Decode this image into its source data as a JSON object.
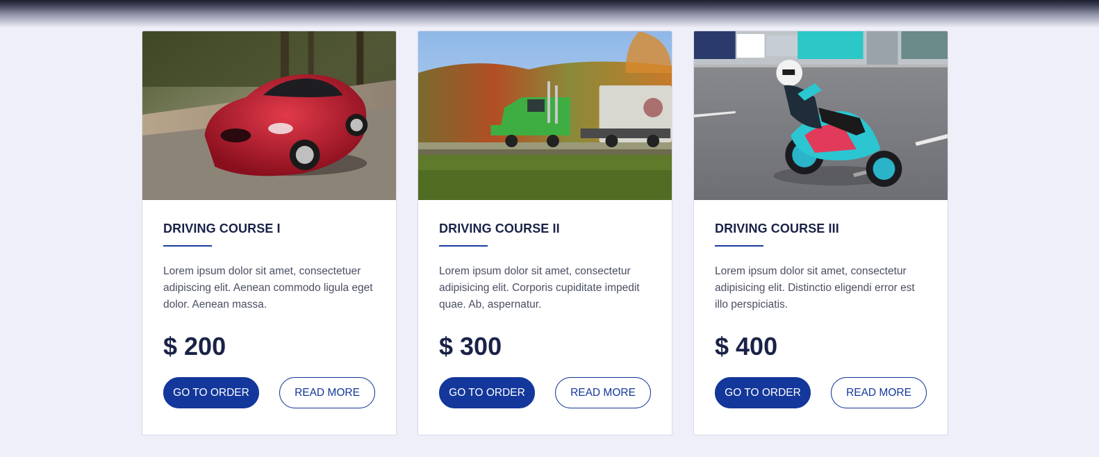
{
  "courses": [
    {
      "image": "red-sports-car-photo",
      "title": "DRIVING COURSE I",
      "description": "Lorem ipsum dolor sit amet, consectetuer adipiscing elit. Aenean commodo ligula eget dolor. Aenean massa.",
      "price": "$ 200",
      "order_label": "GO TO ORDER",
      "more_label": "READ MORE"
    },
    {
      "image": "green-truck-photo",
      "title": "DRIVING COURSE II",
      "description": "Lorem ipsum dolor sit amet, consectetur adipisicing elit. Corporis cupiditate impedit quae. Ab, aspernatur.",
      "price": "$ 300",
      "order_label": "GO TO ORDER",
      "more_label": "READ MORE"
    },
    {
      "image": "motorcycle-racer-photo",
      "title": "DRIVING COURSE III",
      "description": "Lorem ipsum dolor sit amet, consectetur adipisicing elit. Distinctio eligendi error est illo perspiciatis.",
      "price": "$ 400",
      "order_label": "GO TO ORDER",
      "more_label": "READ MORE"
    }
  ],
  "colors": {
    "accent": "#13379a",
    "title": "#1a2247",
    "background": "#efeff9"
  }
}
